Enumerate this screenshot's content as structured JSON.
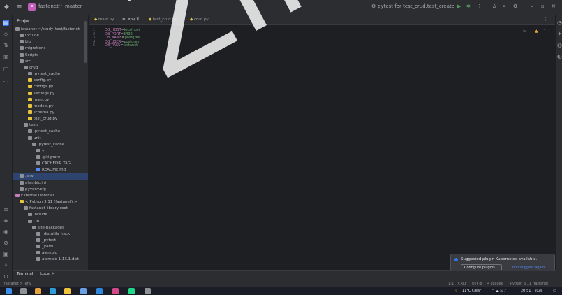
{
  "titlebar": {
    "project_badge": "F",
    "project_name": "fastanet",
    "branch": "master",
    "run_config": "pytest for test_crud.test_create",
    "icons": [
      "menu-icon",
      "run-icon",
      "debug-icon",
      "more-icon",
      "user-icon",
      "search-icon",
      "settings-icon",
      "minimize-icon",
      "restore-icon",
      "close-icon"
    ]
  },
  "project_panel": {
    "title": "Project",
    "rows": [
      {
        "label": "fastanet ~/study_test/fastanet",
        "indent": 0,
        "type": "folder"
      },
      {
        "label": "include",
        "indent": 1,
        "type": "folder"
      },
      {
        "label": "Lib",
        "indent": 1,
        "type": "folder"
      },
      {
        "label": "migrations",
        "indent": 1,
        "type": "folder"
      },
      {
        "label": "Scripts",
        "indent": 1,
        "type": "folder"
      },
      {
        "label": "src",
        "indent": 1,
        "type": "folder"
      },
      {
        "label": "crud",
        "indent": 2,
        "type": "folder"
      },
      {
        "label": ".pytest_cache",
        "indent": 3,
        "type": "folder"
      },
      {
        "label": "config.py",
        "indent": 3,
        "type": "py"
      },
      {
        "label": "configs.py",
        "indent": 3,
        "type": "py"
      },
      {
        "label": "settings.py",
        "indent": 3,
        "type": "py"
      },
      {
        "label": "main.py",
        "indent": 3,
        "type": "py"
      },
      {
        "label": "models.py",
        "indent": 3,
        "type": "py"
      },
      {
        "label": "schema.py",
        "indent": 3,
        "type": "py"
      },
      {
        "label": "test_crud.py",
        "indent": 3,
        "type": "py"
      },
      {
        "label": "tests",
        "indent": 2,
        "type": "folder"
      },
      {
        "label": ".pytest_cache",
        "indent": 3,
        "type": "folder"
      },
      {
        "label": "unit",
        "indent": 3,
        "type": "folder"
      },
      {
        "label": ".pytest_cache",
        "indent": 4,
        "type": "folder"
      },
      {
        "label": "v",
        "indent": 5,
        "type": "folder"
      },
      {
        "label": ".gitignore",
        "indent": 5,
        "type": "file"
      },
      {
        "label": "CACHEDIR.TAG",
        "indent": 5,
        "type": "file"
      },
      {
        "label": "README.md",
        "indent": 5,
        "type": "md"
      },
      {
        "label": ".env",
        "indent": 1,
        "type": "env",
        "selected": true
      },
      {
        "label": "alembic.ini",
        "indent": 1,
        "type": "file"
      },
      {
        "label": "pyvenv.cfg",
        "indent": 1,
        "type": "file"
      },
      {
        "label": "External Libraries",
        "indent": 0,
        "type": "lib"
      },
      {
        "label": "< Python 3.11 (fastanet) >",
        "indent": 1,
        "type": "py"
      },
      {
        "label": "fastanet  library root",
        "indent": 2,
        "type": "folder"
      },
      {
        "label": "include",
        "indent": 3,
        "type": "folder"
      },
      {
        "label": "Lib",
        "indent": 3,
        "type": "folder"
      },
      {
        "label": "site-packages",
        "indent": 4,
        "type": "folder"
      },
      {
        "label": "_distutils_hack",
        "indent": 5,
        "type": "folder"
      },
      {
        "label": "_pytest",
        "indent": 5,
        "type": "folder"
      },
      {
        "label": "_yaml",
        "indent": 5,
        "type": "folder"
      },
      {
        "label": "alembic",
        "indent": 5,
        "type": "folder"
      },
      {
        "label": "alembic-1.13.1.dist",
        "indent": 5,
        "type": "folder"
      }
    ]
  },
  "editor": {
    "tabs": [
      {
        "label": "main.py",
        "active": false
      },
      {
        "label": ".env",
        "active": true
      },
      {
        "label": "test_crud.py",
        "active": false
      },
      {
        "label": "crud.py",
        "active": false
      }
    ],
    "lines": [
      {
        "num": "1",
        "key": "DB_HOST",
        "value": "localhost"
      },
      {
        "num": "2",
        "key": "DB_PORT",
        "value": "5432"
      },
      {
        "num": "3",
        "key": "DB_NAME",
        "value": "postgres"
      },
      {
        "num": "4",
        "key": "DB_USER",
        "value": "postgres"
      },
      {
        "num": "5",
        "key": "DB_PASS",
        "value": "fastanet"
      }
    ]
  },
  "terminal": {
    "title": "Terminal",
    "tab": "Local",
    "breadcrumb": "fastanet > .env"
  },
  "notification": {
    "message": "Suggested plugin Kubernetes available.",
    "configure_label": "Configure plugins...",
    "dismiss_label": "Don't suggest again"
  },
  "statusbar": {
    "position": "1:1",
    "line_ending": "CRLF",
    "encoding": "UTF-8",
    "indent": "4 spaces",
    "interpreter": "Python 3.11 (fastanet)"
  },
  "taskbar": {
    "weather": "11°C Clear",
    "time": "20:51",
    "date": "2024",
    "apps": [
      "start-icon",
      "search-icon",
      "chrome-icon",
      "browser-icon",
      "files-icon",
      "store-icon",
      "vscode-icon",
      "docker-icon",
      "pycharm-icon",
      "app-icon"
    ],
    "colors": [
      "#3b8eea",
      "#8f9196",
      "#e8a33d",
      "#2f9bd8",
      "#f0c33c",
      "#6aa0e6",
      "#2e87d8",
      "#d24a8a",
      "#21d789",
      "#8f9196"
    ]
  },
  "watermark": "Ziketov",
  "colors": {
    "accent": "#3574f0",
    "key": "#c77dbb",
    "value": "#6aab73",
    "badge": "#c25fba"
  }
}
